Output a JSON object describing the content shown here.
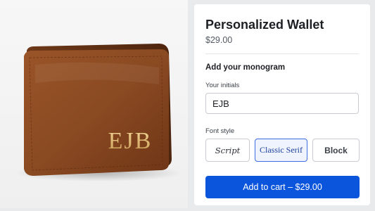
{
  "product": {
    "title": "Personalized Wallet",
    "price": "$29.00"
  },
  "photo": {
    "monogram_on_wallet": "EJB",
    "leather_color": "#8a4a22",
    "foil_color": "#e2bd74"
  },
  "monogram": {
    "heading": "Add your monogram",
    "initials_label": "Your initials",
    "initials_value": "EJB",
    "font_style_label": "Font style",
    "font_styles": [
      "Script",
      "Classic Serif",
      "Block"
    ],
    "selected_style": "Classic Serif"
  },
  "cart": {
    "button_label": "Add to cart – $29.00"
  },
  "colors": {
    "accent": "#0b55dd",
    "selected_border": "#3d6de0"
  }
}
